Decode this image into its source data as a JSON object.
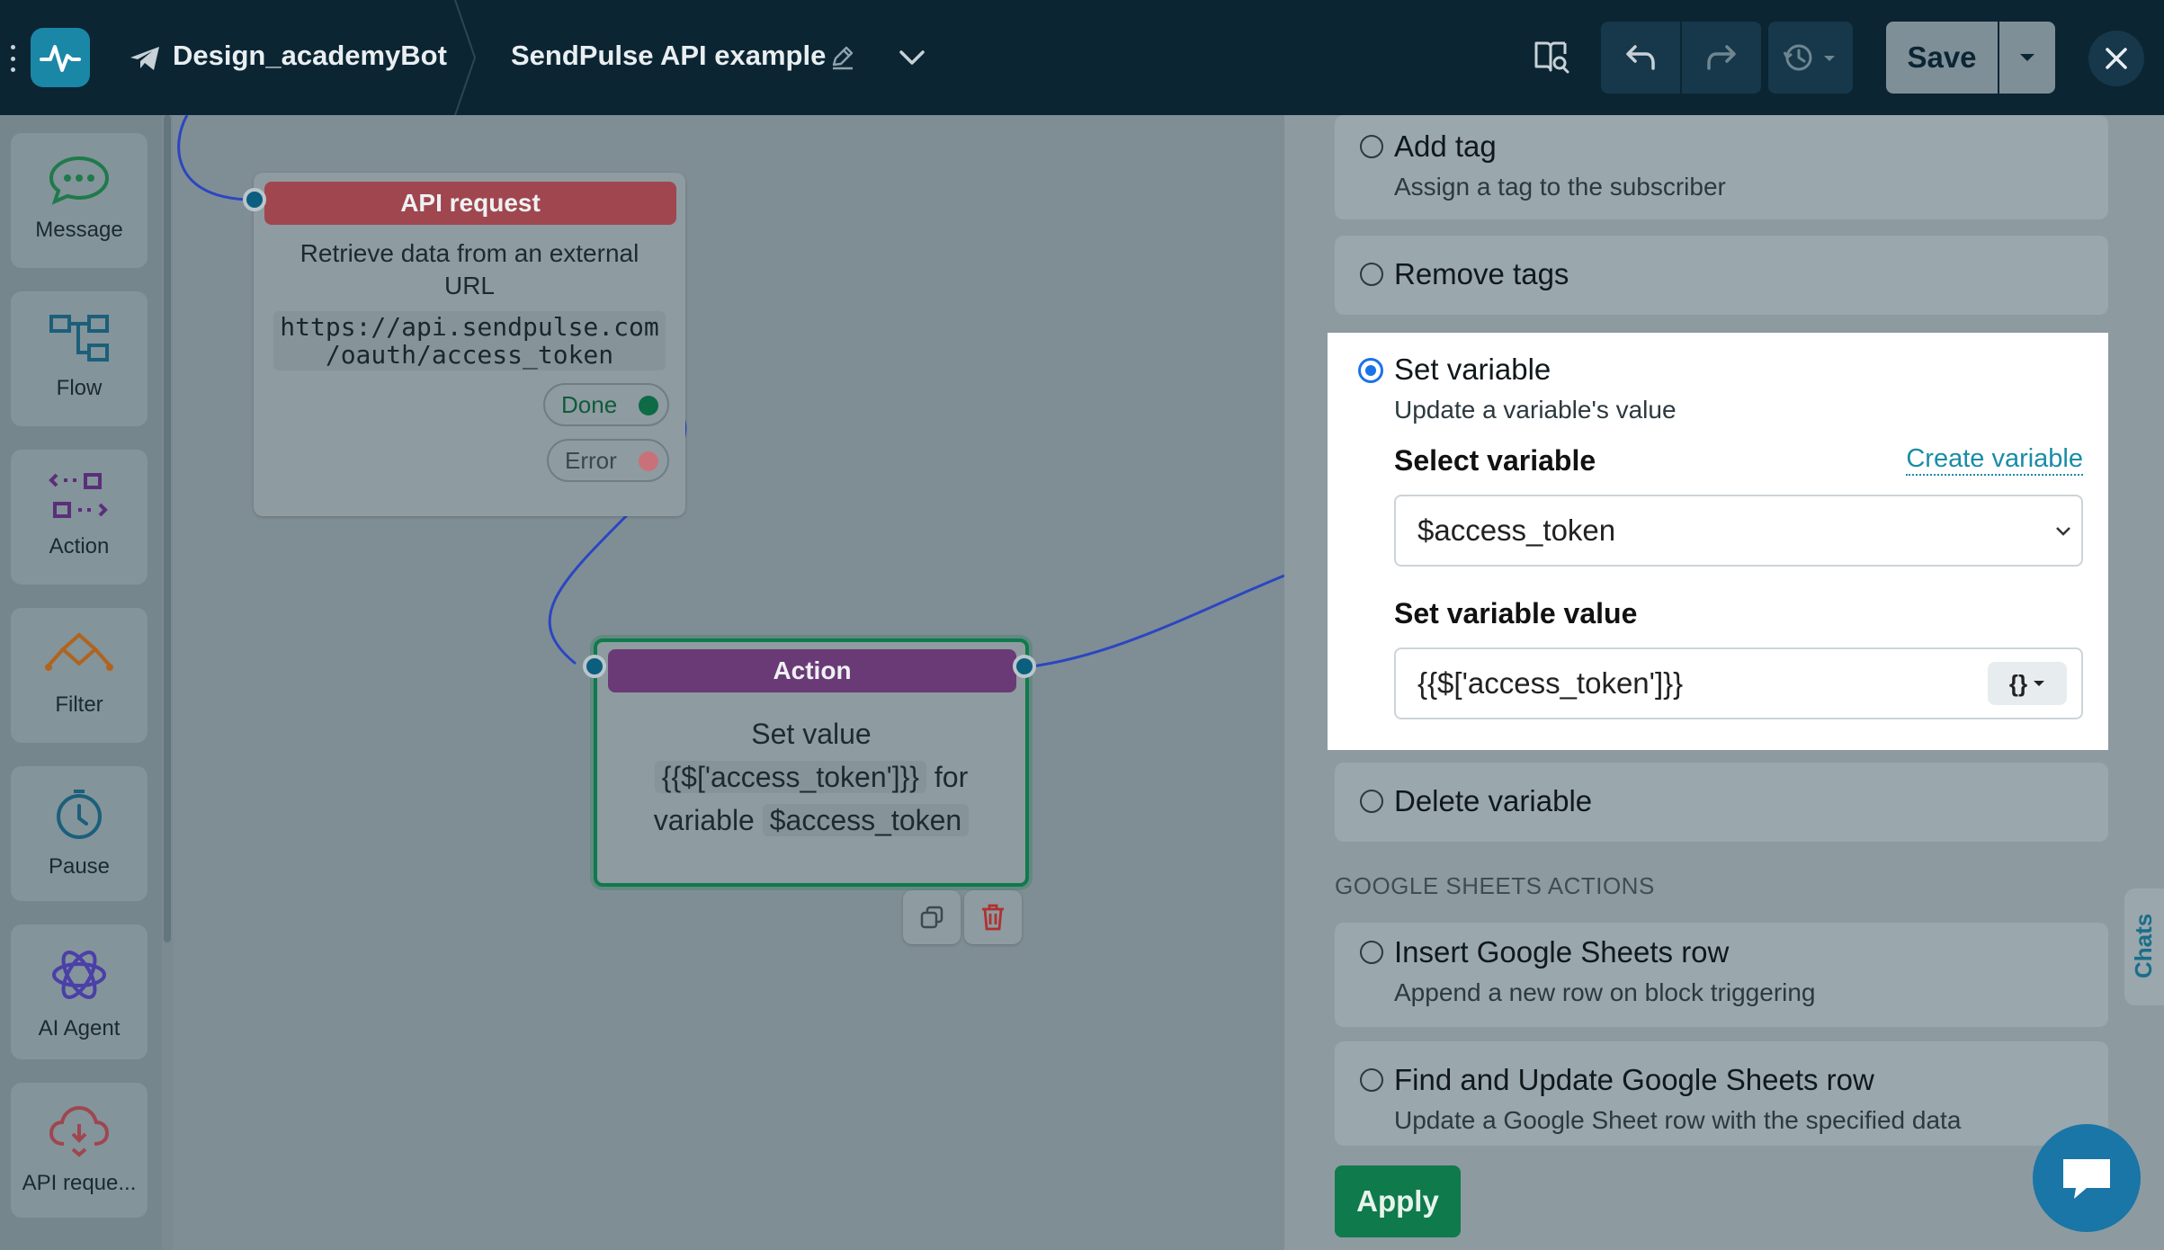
{
  "colors": {
    "topbar": "#0b2533",
    "brand": "#1b87a6",
    "api_header": "#a0464f",
    "action_header": "#6a3a76",
    "success": "#0f7a4c",
    "link": "#1a8ca8",
    "radio_active": "#1a73e8"
  },
  "header": {
    "bot_name": "Design_academyBot",
    "flow_name": "SendPulse API example",
    "save_label": "Save",
    "icons": [
      "menu-dots-icon",
      "brand-logo-icon",
      "telegram-icon",
      "pencil-icon",
      "chevron-down-icon",
      "book-search-icon",
      "undo-icon",
      "redo-icon",
      "history-icon",
      "close-icon"
    ]
  },
  "sidebar": {
    "items": [
      {
        "label": "Message",
        "icon": "message-icon"
      },
      {
        "label": "Flow",
        "icon": "flow-icon"
      },
      {
        "label": "Action",
        "icon": "action-icon"
      },
      {
        "label": "Filter",
        "icon": "filter-icon"
      },
      {
        "label": "Pause",
        "icon": "clock-icon"
      },
      {
        "label": "AI Agent",
        "icon": "ai-agent-icon"
      },
      {
        "label": "API reque...",
        "icon": "api-cloud-icon"
      }
    ]
  },
  "canvas": {
    "api_node": {
      "title": "API request",
      "description": "Retrieve data from an external URL",
      "url_line1": "https://api.sendpulse.com",
      "url_line2": "/oauth/access_token",
      "done_label": "Done",
      "error_label": "Error"
    },
    "action_node": {
      "title": "Action",
      "text_set_value": "Set value",
      "value_chip": "{{$['access_token']}}",
      "text_for": "for",
      "text_variable": "variable",
      "variable_chip": "$access_token"
    }
  },
  "panel": {
    "options": {
      "add_tag": {
        "title": "Add tag",
        "subtitle": "Assign a tag to the subscriber"
      },
      "remove_tags": {
        "title": "Remove tags"
      },
      "set_variable": {
        "title": "Set variable",
        "subtitle": "Update a variable's value",
        "select_label": "Select variable",
        "create_link": "Create variable",
        "selected_variable": "$access_token",
        "value_label": "Set variable value",
        "value": "{{$['access_token']}}",
        "var_button": "{}"
      },
      "delete_variable": {
        "title": "Delete variable"
      }
    },
    "google_section": "GOOGLE SHEETS ACTIONS",
    "google_options": {
      "insert_row": {
        "title": "Insert Google Sheets row",
        "subtitle": "Append a new row on block triggering"
      },
      "update_row": {
        "title": "Find and Update Google Sheets row",
        "subtitle": "Update a Google Sheet row with the specified data"
      }
    },
    "apply_label": "Apply",
    "chats_tab": "Chats"
  }
}
